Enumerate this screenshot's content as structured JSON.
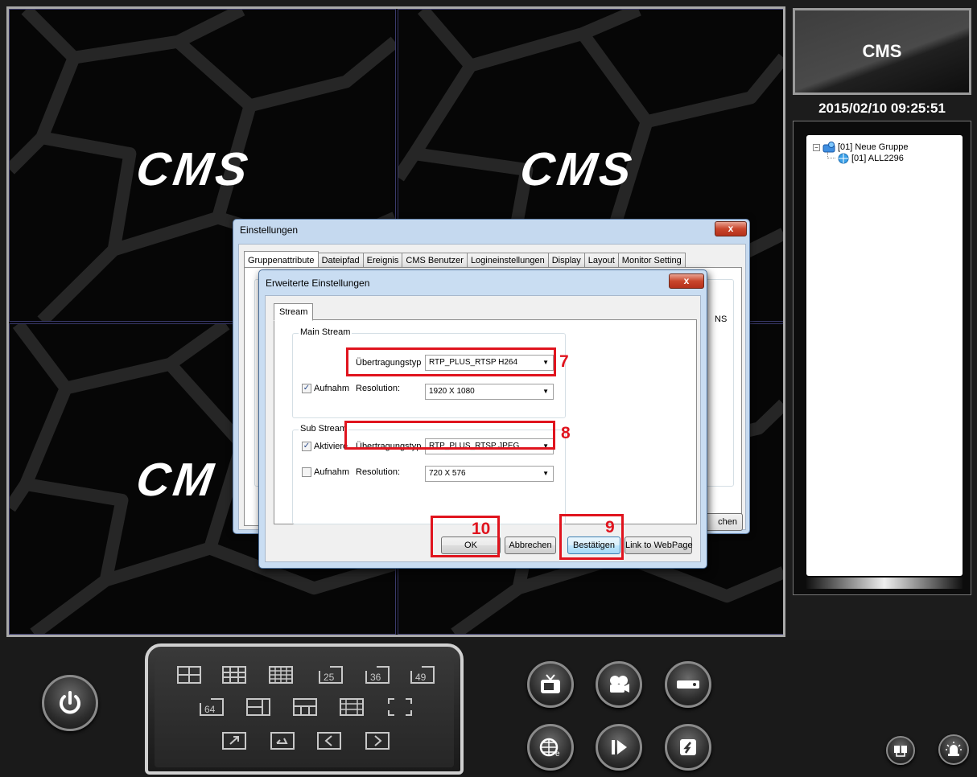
{
  "video": {
    "cells": [
      {
        "logo": "CMS"
      },
      {
        "logo": "CMS"
      },
      {
        "logo": "CM"
      },
      {
        "logo": ""
      }
    ]
  },
  "side": {
    "brand": "CMS",
    "clock": "2015/02/10 09:25:51",
    "tree": {
      "group": "[01] Neue Gruppe",
      "device": "[01] ALL2296"
    }
  },
  "settings_dialog": {
    "title": "Einstellungen",
    "close": "x",
    "tabs": [
      "Gruppenattribute",
      "Dateipfad",
      "Ereignis",
      "CMS Benutzer",
      "Logineinstellungen",
      "Display",
      "Layout",
      "Monitor Setting"
    ],
    "partial_text": "NS",
    "partial_button": "chen"
  },
  "advanced_dialog": {
    "title": "Erweiterte Einstellungen",
    "close": "x",
    "tab": "Stream",
    "main_stream": {
      "legend": "Main Stream",
      "type_label": "Übertragungstyp",
      "type_value": "RTP_PLUS_RTSP H264",
      "record_label": "Aufnahm",
      "record_checked": true,
      "resolution_label": "Resolution:",
      "resolution_value": "1920 X 1080"
    },
    "sub_stream": {
      "legend": "Sub Stream",
      "activate_label": "Aktiviere",
      "activate_checked": true,
      "type_label": "Übertragungstyp",
      "type_value": "RTP_PLUS_RTSP JPEG",
      "record_label": "Aufnahm",
      "record_checked": false,
      "resolution_label": "Resolution:",
      "resolution_value": "720 X 576"
    },
    "buttons": {
      "ok": "OK",
      "cancel": "Abbrechen",
      "confirm": "Bestätigen",
      "link": "Link to WebPage"
    }
  },
  "annotations": {
    "n7": "7",
    "n8": "8",
    "n9": "9",
    "n10": "10",
    "color": "#e0141e"
  },
  "layout_panel": {
    "labels": {
      "l25": "25",
      "l36": "36",
      "l49": "49",
      "l64": "64"
    },
    "icons": [
      "split-4-icon",
      "split-9-icon",
      "split-16-icon",
      "split-25-icon",
      "split-36-icon",
      "split-49-icon",
      "split-64-icon",
      "split-6-icon",
      "split-8-icon",
      "split-13-icon",
      "fullscreen-icon",
      "popout-icon",
      "return-icon",
      "prev-page-icon",
      "next-page-icon"
    ]
  },
  "controls": {
    "icons": [
      "power-icon",
      "tv-icon",
      "camera-icon",
      "dvr-icon",
      "web-icon",
      "playback-icon",
      "backup-icon",
      "network-icon",
      "alarm-icon"
    ]
  }
}
